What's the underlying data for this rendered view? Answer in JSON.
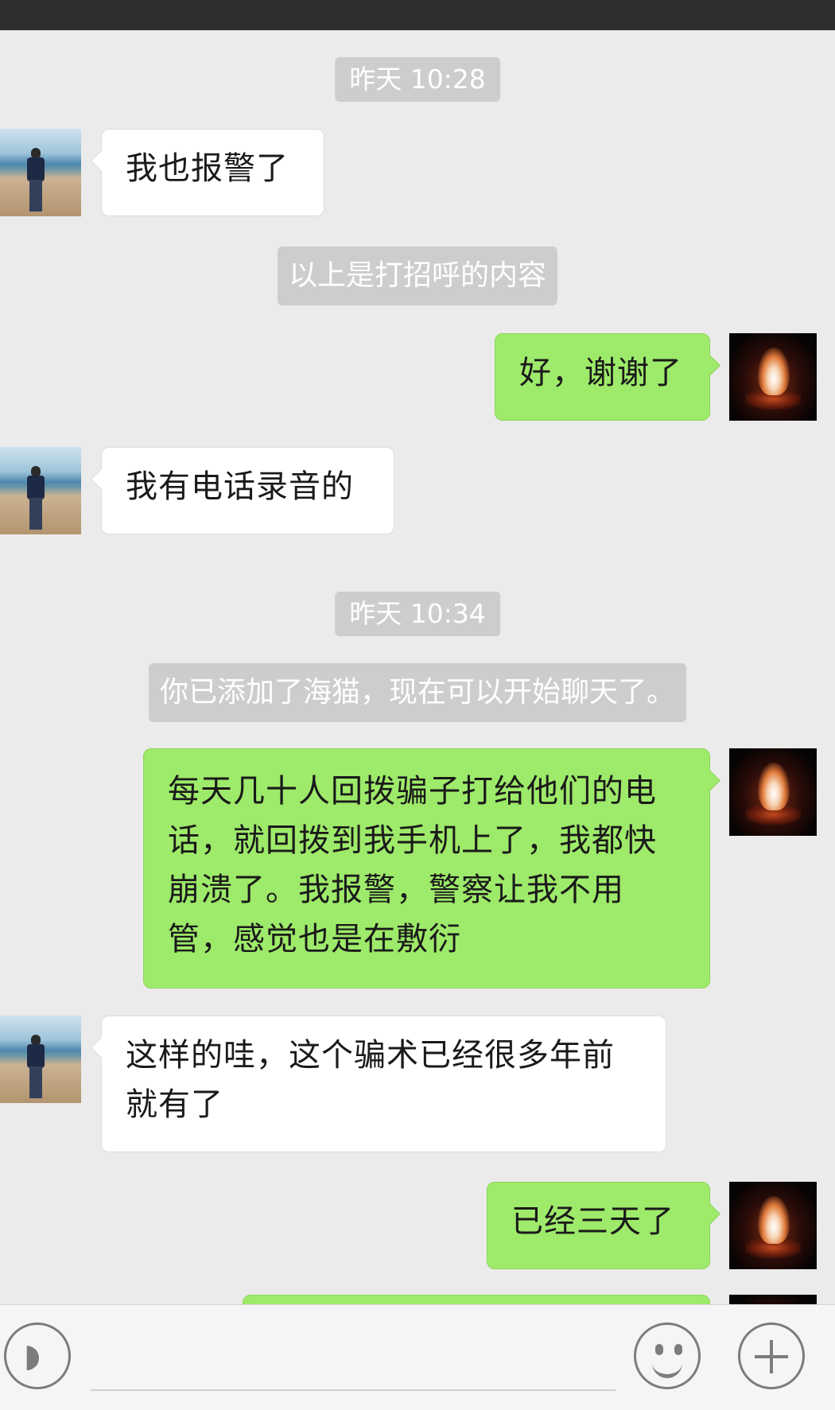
{
  "chat": {
    "timestamps": [
      "昨天 10:28",
      "昨天 10:34"
    ],
    "system_messages": [
      "以上是打招呼的内容",
      "你已添加了海猫，现在可以开始聊天了。"
    ],
    "messages": [
      {
        "side": "left",
        "text": "我也报警了"
      },
      {
        "side": "right",
        "text": "好，谢谢了"
      },
      {
        "side": "left",
        "text": "我有电话录音的"
      },
      {
        "side": "right",
        "text": "每天几十人回拨骗子打给他们的电话，就回拨到我手机上了，我都快崩溃了。我报警，警察让我不用管，感觉也是在敷衍"
      },
      {
        "side": "left",
        "text": "这样的哇，这个骗术已经很多年前就有了"
      },
      {
        "side": "right",
        "text": "已经三天了"
      }
    ]
  },
  "avatars": {
    "contact": "beach-photo-avatar",
    "self": "fire-photo-avatar"
  },
  "input_bar": {
    "voice_icon": "voice-icon",
    "emoji_icon": "emoji-icon",
    "plus_icon": "plus-icon"
  },
  "colors": {
    "sent_bubble": "#9eea6a",
    "received_bubble": "#ffffff",
    "background": "#ebebeb"
  }
}
